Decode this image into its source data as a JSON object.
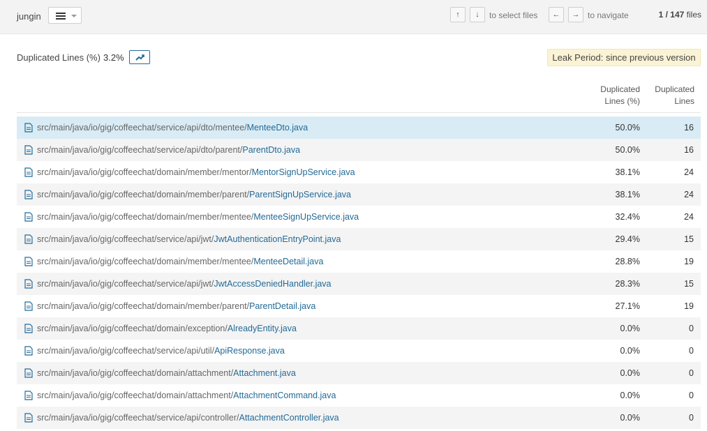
{
  "header": {
    "project": "jungin",
    "view_icon": "list-icon",
    "select_keys": [
      "↑",
      "↓"
    ],
    "select_hint": "to select files",
    "nav_keys": [
      "←",
      "→"
    ],
    "nav_hint": "to navigate",
    "files_position": "1 / 147",
    "files_label": "files"
  },
  "metric": {
    "label": "Duplicated Lines (%)",
    "value": "3.2%",
    "trend_icon": "trend-chart-icon",
    "leak_period": "Leak Period: since previous version"
  },
  "table": {
    "columns": {
      "pct_line1": "Duplicated",
      "pct_line2": "Lines (%)",
      "lines_line1": "Duplicated",
      "lines_line2": "Lines"
    },
    "rows": [
      {
        "dir": "src/main/java/io/gig/coffeechat/service/api/dto/mentee/",
        "file": "MenteeDto.java",
        "pct": "50.0%",
        "lines": "16"
      },
      {
        "dir": "src/main/java/io/gig/coffeechat/service/api/dto/parent/",
        "file": "ParentDto.java",
        "pct": "50.0%",
        "lines": "16"
      },
      {
        "dir": "src/main/java/io/gig/coffeechat/domain/member/mentor/",
        "file": "MentorSignUpService.java",
        "pct": "38.1%",
        "lines": "24"
      },
      {
        "dir": "src/main/java/io/gig/coffeechat/domain/member/parent/",
        "file": "ParentSignUpService.java",
        "pct": "38.1%",
        "lines": "24"
      },
      {
        "dir": "src/main/java/io/gig/coffeechat/domain/member/mentee/",
        "file": "MenteeSignUpService.java",
        "pct": "32.4%",
        "lines": "24"
      },
      {
        "dir": "src/main/java/io/gig/coffeechat/service/api/jwt/",
        "file": "JwtAuthenticationEntryPoint.java",
        "pct": "29.4%",
        "lines": "15"
      },
      {
        "dir": "src/main/java/io/gig/coffeechat/domain/member/mentee/",
        "file": "MenteeDetail.java",
        "pct": "28.8%",
        "lines": "19"
      },
      {
        "dir": "src/main/java/io/gig/coffeechat/service/api/jwt/",
        "file": "JwtAccessDeniedHandler.java",
        "pct": "28.3%",
        "lines": "15"
      },
      {
        "dir": "src/main/java/io/gig/coffeechat/domain/member/parent/",
        "file": "ParentDetail.java",
        "pct": "27.1%",
        "lines": "19"
      },
      {
        "dir": "src/main/java/io/gig/coffeechat/domain/exception/",
        "file": "AlreadyEntity.java",
        "pct": "0.0%",
        "lines": "0"
      },
      {
        "dir": "src/main/java/io/gig/coffeechat/service/api/util/",
        "file": "ApiResponse.java",
        "pct": "0.0%",
        "lines": "0"
      },
      {
        "dir": "src/main/java/io/gig/coffeechat/domain/attachment/",
        "file": "Attachment.java",
        "pct": "0.0%",
        "lines": "0"
      },
      {
        "dir": "src/main/java/io/gig/coffeechat/domain/attachment/",
        "file": "AttachmentCommand.java",
        "pct": "0.0%",
        "lines": "0"
      },
      {
        "dir": "src/main/java/io/gig/coffeechat/service/api/controller/",
        "file": "AttachmentController.java",
        "pct": "0.0%",
        "lines": "0"
      }
    ],
    "file_icon": "file-icon",
    "selected_row": 0
  }
}
